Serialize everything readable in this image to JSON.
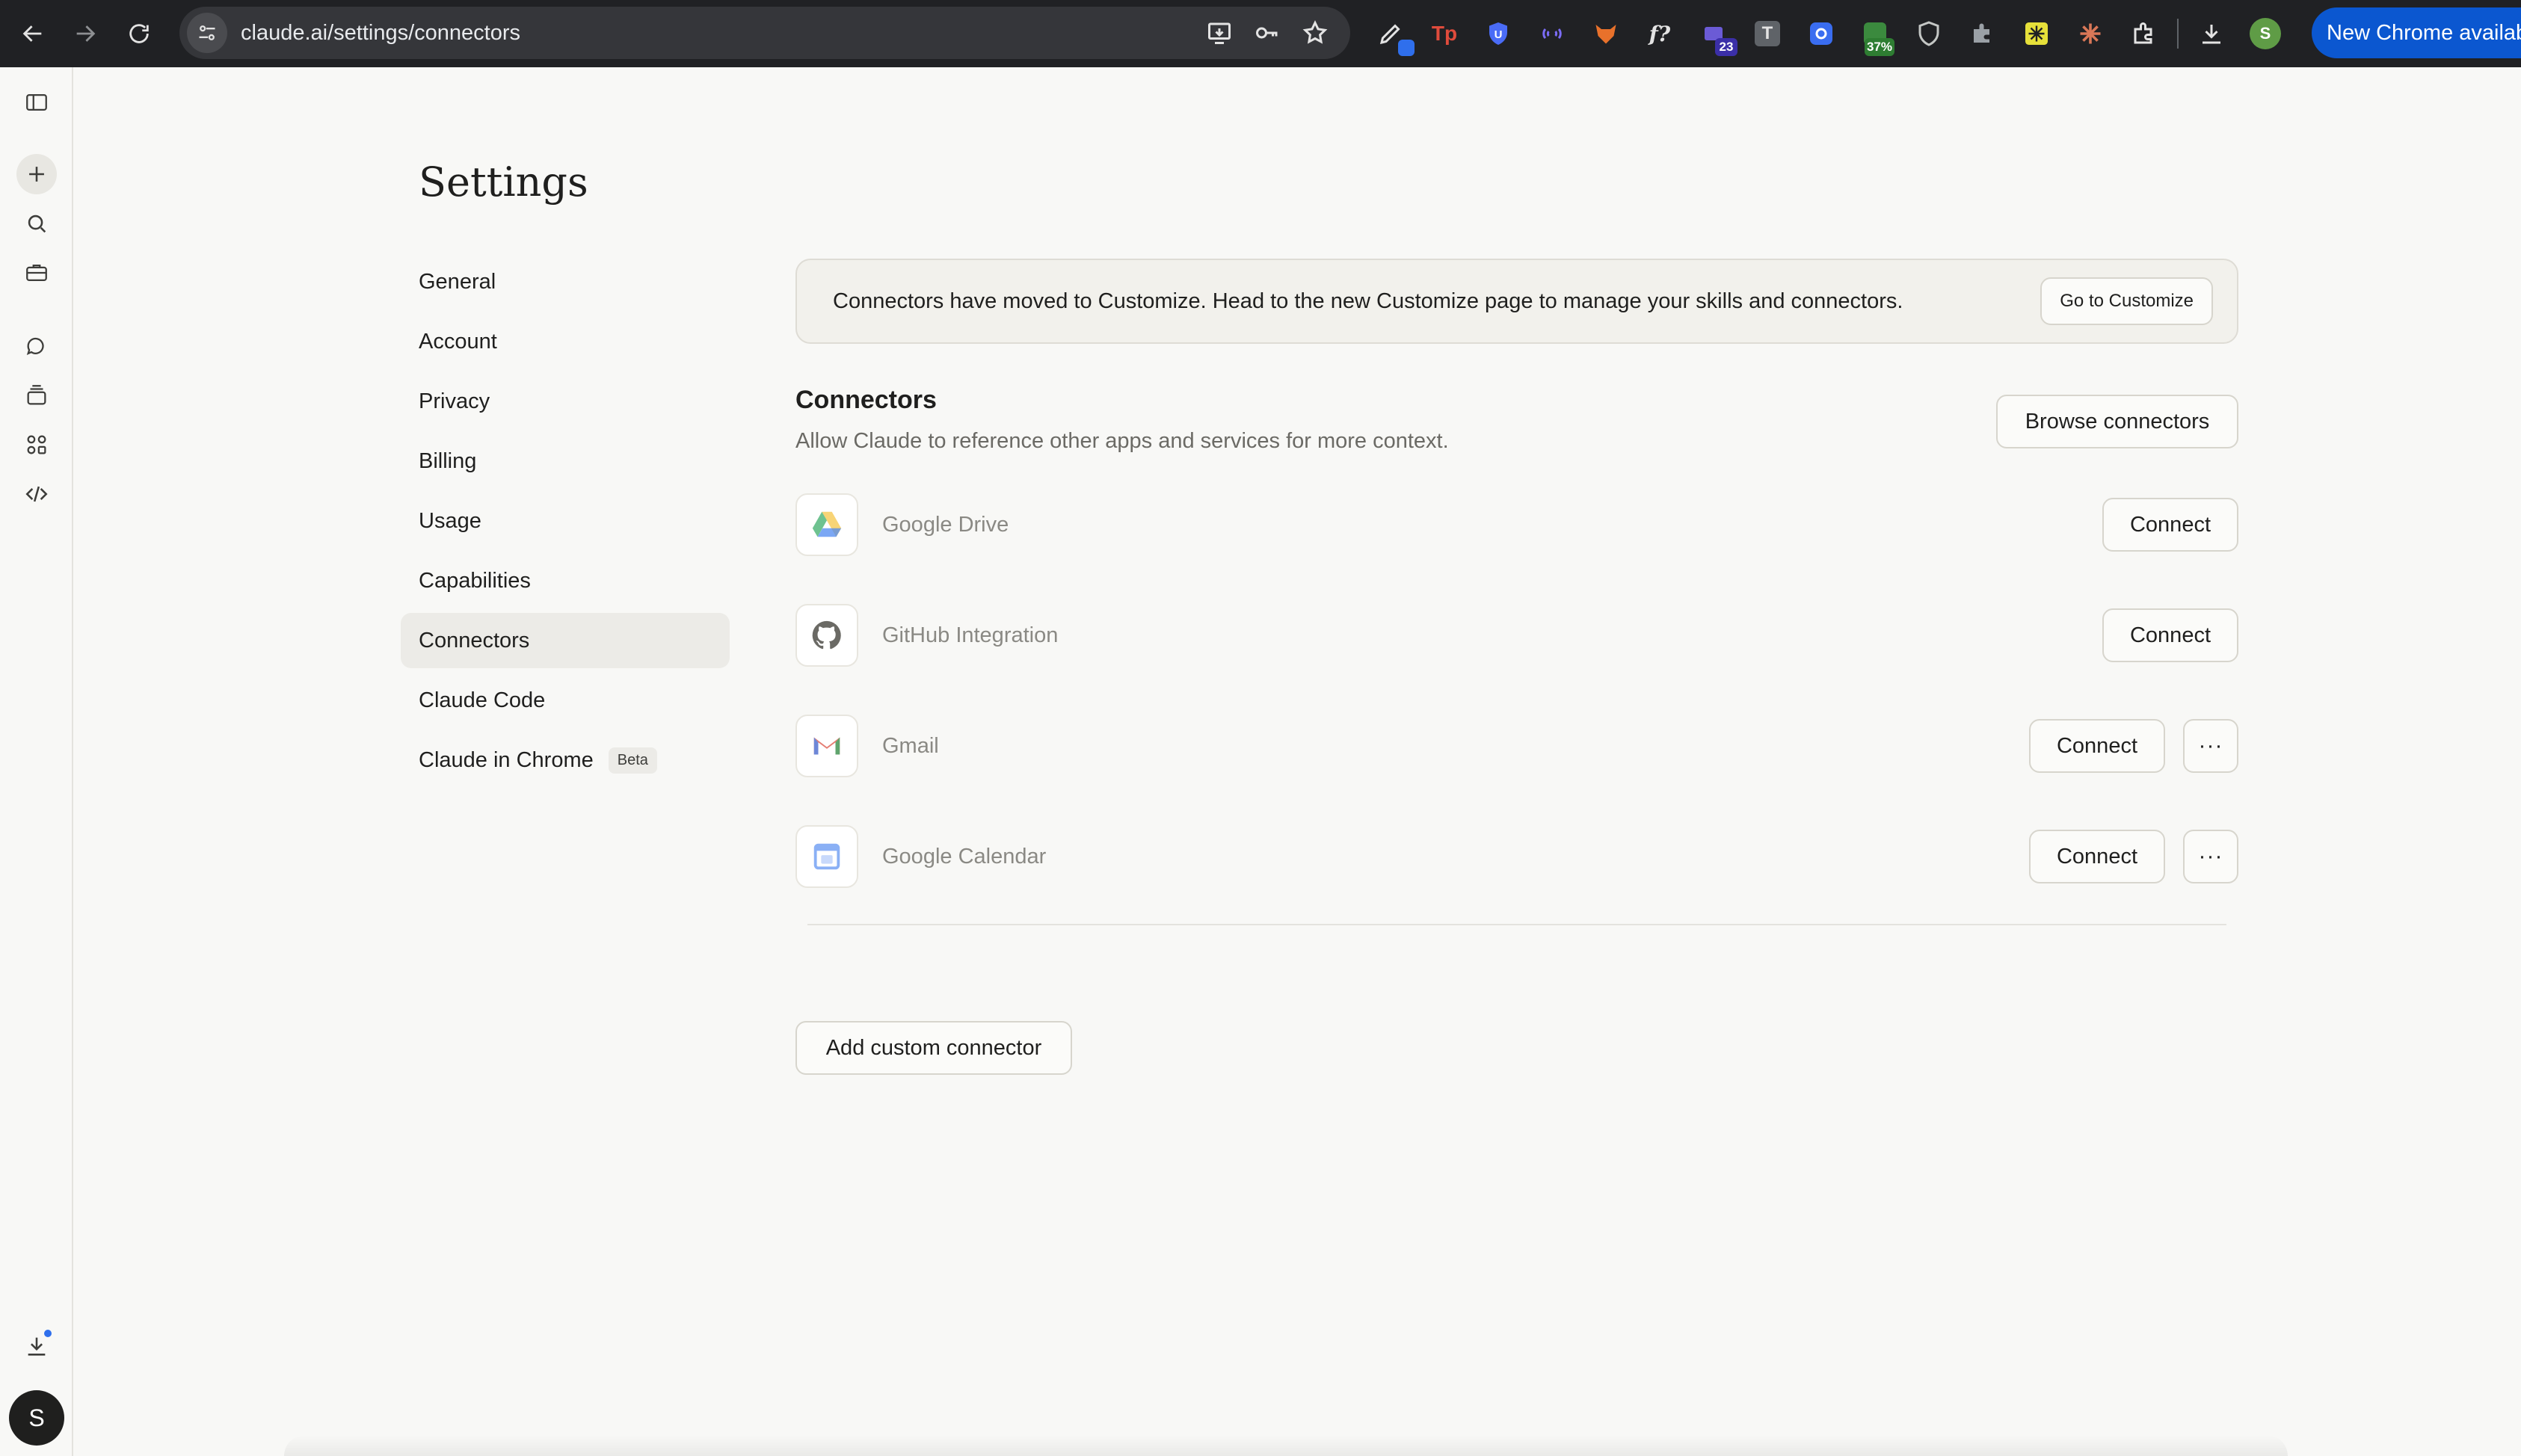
{
  "browser": {
    "url": "claude.ai/settings/connectors",
    "update_label": "New Chrome availabl",
    "profile_initial": "S",
    "extensions": [
      {
        "icon": "pen-icon",
        "badge": ""
      },
      {
        "icon": "tp-icon",
        "label": "Tp"
      },
      {
        "icon": "shield-u-icon",
        "label": "U"
      },
      {
        "icon": "wave-icon",
        "label": ""
      },
      {
        "icon": "fox-icon",
        "label": ""
      },
      {
        "icon": "fx-icon",
        "label": "f?"
      },
      {
        "icon": "stack-icon",
        "badge": "23"
      },
      {
        "icon": "t-icon",
        "label": "T"
      },
      {
        "icon": "gear-icon",
        "label": ""
      },
      {
        "icon": "percent-icon",
        "badge": "37%"
      },
      {
        "icon": "shield-icon",
        "label": ""
      },
      {
        "icon": "puzzle-grey-icon",
        "label": ""
      },
      {
        "icon": "sparkle-icon",
        "label": ""
      },
      {
        "icon": "asterisk-icon",
        "label": ""
      },
      {
        "icon": "puzzle-icon",
        "label": ""
      }
    ]
  },
  "rail": {
    "avatar_initial": "S"
  },
  "settings": {
    "title": "Settings",
    "nav": [
      {
        "label": "General",
        "active": false
      },
      {
        "label": "Account",
        "active": false
      },
      {
        "label": "Privacy",
        "active": false
      },
      {
        "label": "Billing",
        "active": false
      },
      {
        "label": "Usage",
        "active": false
      },
      {
        "label": "Capabilities",
        "active": false
      },
      {
        "label": "Connectors",
        "active": true
      },
      {
        "label": "Claude Code",
        "active": false
      },
      {
        "label": "Claude in Chrome",
        "active": false,
        "badge": "Beta"
      }
    ]
  },
  "banner": {
    "text": "Connectors have moved to Customize. Head to the new Customize page to manage your skills and connectors.",
    "button": "Go to Customize"
  },
  "connectors": {
    "title": "Connectors",
    "subtitle": "Allow Claude to reference other apps and services for more context.",
    "browse_button": "Browse connectors",
    "items": [
      {
        "name": "Google Drive",
        "button": "Connect",
        "icon": "google-drive-icon",
        "has_more": false
      },
      {
        "name": "GitHub Integration",
        "button": "Connect",
        "icon": "github-icon",
        "has_more": false
      },
      {
        "name": "Gmail",
        "button": "Connect",
        "icon": "gmail-icon",
        "has_more": true
      },
      {
        "name": "Google Calendar",
        "button": "Connect",
        "icon": "google-calendar-icon",
        "has_more": true
      }
    ],
    "more_label": "···",
    "add_custom_button": "Add custom connector"
  }
}
